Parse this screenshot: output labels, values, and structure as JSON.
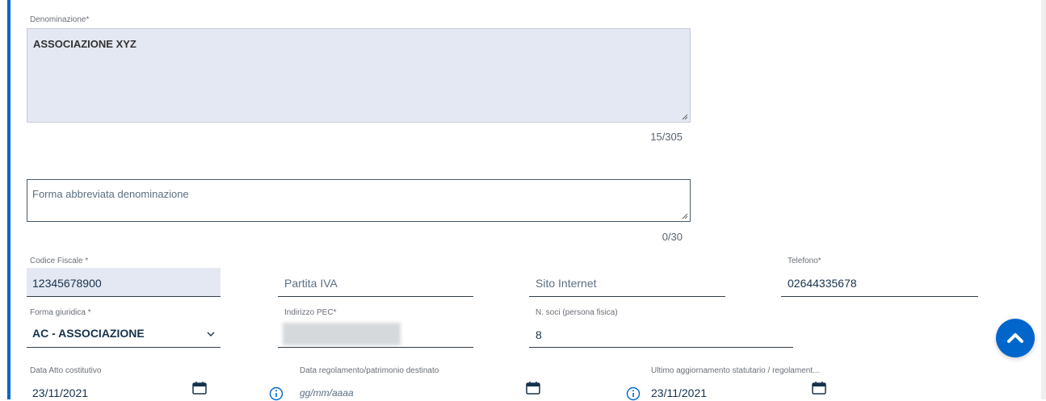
{
  "denominazione": {
    "label": "Denominazione*",
    "value": "ASSOCIAZIONE XYZ",
    "counter": "15/305"
  },
  "forma_abbreviata": {
    "placeholder": "Forma abbreviata denominazione",
    "counter": "0/30"
  },
  "codice_fiscale": {
    "label": "Codice Fiscale *",
    "value": "12345678900"
  },
  "partita_iva": {
    "placeholder": "Partita IVA"
  },
  "sito_internet": {
    "placeholder": "Sito Internet"
  },
  "telefono": {
    "label": "Telefono*",
    "value": "02644335678"
  },
  "forma_giuridica": {
    "label": "Forma giuridica *",
    "value": "AC - ASSOCIAZIONE"
  },
  "indirizzo_pec": {
    "label": "Indirizzo PEC*"
  },
  "n_soci": {
    "label": "N. soci (persona fisica)",
    "value": "8"
  },
  "data_atto": {
    "label": "Data Atto costitutivo",
    "value": "23/11/2021"
  },
  "data_regolamento": {
    "label": "Data regolamento/patrimonio destinato",
    "placeholder": "gg/mm/aaaa"
  },
  "ultimo_aggiornamento": {
    "label": "Ultimo aggiornamento statutario / regolament...",
    "value": "23/11/2021"
  },
  "colors": {
    "accent": "#0066cc",
    "filled_bg": "#e4e8f2",
    "text_dark": "#17324d"
  },
  "icons": [
    "calendar-icon",
    "info-icon",
    "chevron-down-icon",
    "chevron-up-icon",
    "resize-grip-icon"
  ]
}
